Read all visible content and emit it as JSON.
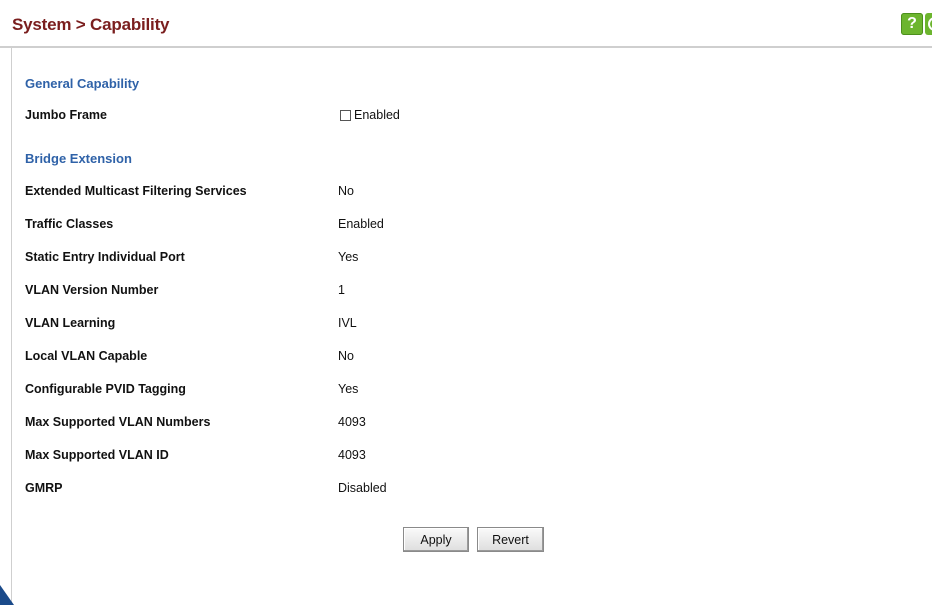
{
  "header": {
    "title": "System > Capability",
    "help_label": "?"
  },
  "general": {
    "title": "General Capability",
    "jumbo_frame": {
      "label": "Jumbo Frame",
      "checkbox_label": "Enabled",
      "checked": false
    }
  },
  "bridge": {
    "title": "Bridge Extension",
    "rows": [
      {
        "label": "Extended Multicast Filtering Services",
        "value": "No"
      },
      {
        "label": "Traffic Classes",
        "value": "Enabled"
      },
      {
        "label": "Static Entry Individual Port",
        "value": "Yes"
      },
      {
        "label": "VLAN Version Number",
        "value": "1"
      },
      {
        "label": "VLAN Learning",
        "value": "IVL"
      },
      {
        "label": "Local VLAN Capable",
        "value": "No"
      },
      {
        "label": "Configurable PVID Tagging",
        "value": "Yes"
      },
      {
        "label": "Max Supported VLAN Numbers",
        "value": "4093"
      },
      {
        "label": "Max Supported VLAN ID",
        "value": "4093"
      },
      {
        "label": "GMRP",
        "value": "Disabled"
      }
    ]
  },
  "buttons": {
    "apply": "Apply",
    "revert": "Revert"
  }
}
